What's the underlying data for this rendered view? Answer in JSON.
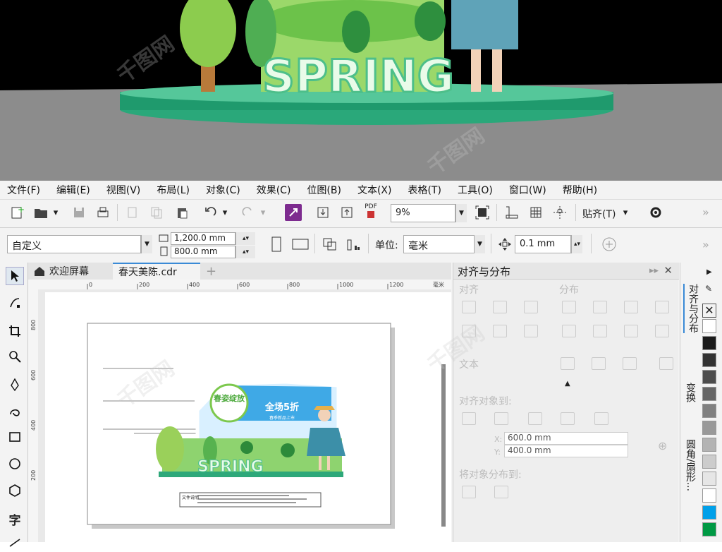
{
  "scene": {
    "sign_text": "SPRING"
  },
  "menubar": [
    "文件(F)",
    "编辑(E)",
    "视图(V)",
    "布局(L)",
    "对象(C)",
    "效果(C)",
    "位图(B)",
    "文本(X)",
    "表格(T)",
    "工具(O)",
    "窗口(W)",
    "帮助(H)"
  ],
  "toolbar": {
    "pdf_label": "PDF",
    "zoom": "9%",
    "snap_label": "贴齐(T)",
    "more": "»"
  },
  "propbar": {
    "preset": "自定义",
    "width": "1,200.0 mm",
    "height": "800.0 mm",
    "unit_label": "单位:",
    "unit": "毫米",
    "nudge": "0.1 mm",
    "more": "»"
  },
  "tabs": {
    "welcome": "欢迎屏幕",
    "file": "春天美陈.cdr",
    "add": "+"
  },
  "ruler": {
    "ticks": [
      "0",
      "200",
      "400",
      "600",
      "800",
      "1000",
      "1200"
    ],
    "unit": "毫米",
    "vticks": [
      "800",
      "600",
      "400",
      "200"
    ]
  },
  "artwork": {
    "sign_main": "春姿绽放",
    "promo": "全场5折",
    "promo_sub": "春季新品上市",
    "spring": "SPRING",
    "note": "文件说明"
  },
  "docker": {
    "title": "对齐与分布",
    "align": "对齐",
    "distribute": "分布",
    "text": "文本",
    "align_to": "对齐对象到:",
    "x": "600.0 mm",
    "y": "400.0 mm",
    "x_label": "X:",
    "y_label": "Y:",
    "distribute_to": "将对象分布到:"
  },
  "vtabs": [
    "对齐与分布",
    "变换",
    "圆角/扇形..."
  ],
  "palette": [
    "#ffffff",
    "#1a1a1a",
    "#333333",
    "#4d4d4d",
    "#666666",
    "#808080",
    "#999999",
    "#b3b3b3",
    "#cccccc",
    "#e6e6e6",
    "#ffffff",
    "#00a0e9",
    "#009944"
  ]
}
